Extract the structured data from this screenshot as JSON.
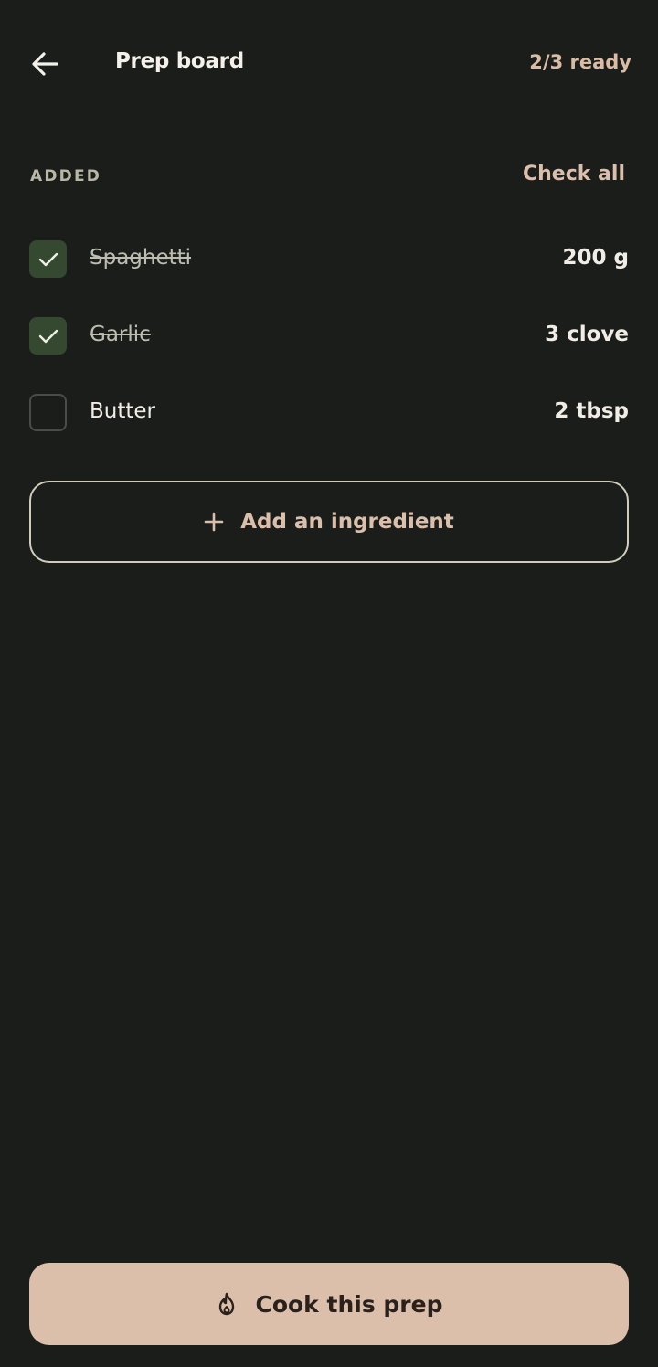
{
  "header": {
    "title": "Prep board",
    "ready_status": "2/3 ready"
  },
  "section": {
    "label": "ADDED",
    "check_all_label": "Check all"
  },
  "ingredients": [
    {
      "name": "Spaghetti",
      "quantity": "200 g",
      "checked": true
    },
    {
      "name": "Garlic",
      "quantity": "3 clove",
      "checked": true
    },
    {
      "name": "Butter",
      "quantity": "2 tbsp",
      "checked": false
    }
  ],
  "add_button": {
    "label": "Add an ingredient",
    "icon": "plus-icon"
  },
  "cook_button": {
    "label": "Cook this prep",
    "icon": "flame-icon"
  },
  "colors": {
    "background": "#1b1d1b",
    "accent": "#dcbfaa",
    "checked_fill": "#34492f"
  }
}
